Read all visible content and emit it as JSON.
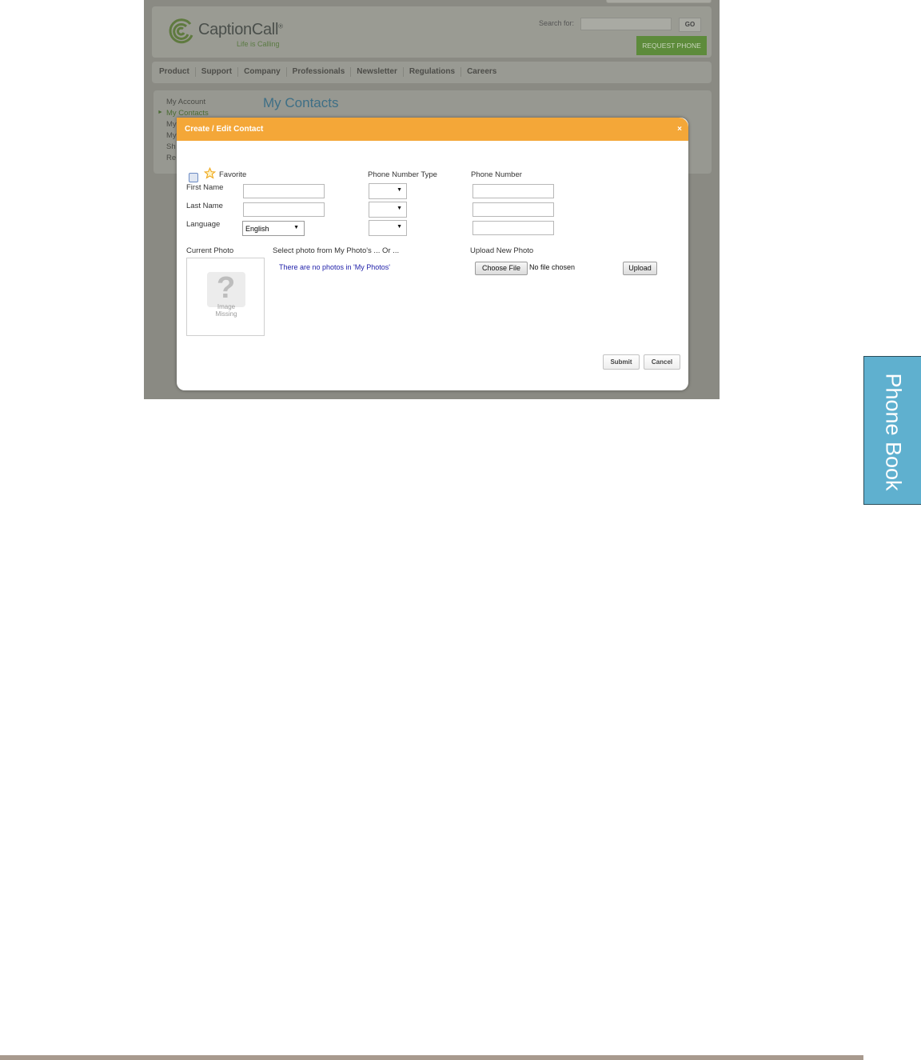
{
  "site": {
    "logo_word": "CaptionCall",
    "logo_reg": "®",
    "tagline": "Life is Calling",
    "search_label": "Search for:",
    "go_label": "GO",
    "request_label": "REQUEST PHONE"
  },
  "nav": [
    "Product",
    "Support",
    "Company",
    "Professionals",
    "Newsletter",
    "Regulations",
    "Careers"
  ],
  "sidebar": {
    "items": [
      "My Account",
      "My Contacts",
      "My",
      "My",
      "Sh",
      "Re"
    ],
    "active_index": 1
  },
  "page_title": "My Contacts",
  "modal": {
    "title": "Create / Edit Contact",
    "close": "×",
    "favorite_label": "Favorite",
    "first_name_label": "First Name",
    "last_name_label": "Last Name",
    "language_label": "Language",
    "language_value": "English",
    "phone_type_label": "Phone Number Type",
    "phone_number_label": "Phone Number",
    "current_photo_label": "Current Photo",
    "select_photo_label": "Select photo from My Photo's ... Or ...",
    "upload_new_label": "Upload New Photo",
    "no_photos_text": "There are no photos in 'My Photos'",
    "image_missing_line1": "Image",
    "image_missing_line2": "Missing",
    "choose_file_label": "Choose File",
    "no_file_text": "No file chosen",
    "upload_label": "Upload",
    "submit_label": "Submit",
    "cancel_label": "Cancel"
  },
  "section_tab": "Phone Book",
  "colors": {
    "modal_header": "#f4a738",
    "tab": "#5fb0cf",
    "request_button": "#5d8b3b"
  }
}
